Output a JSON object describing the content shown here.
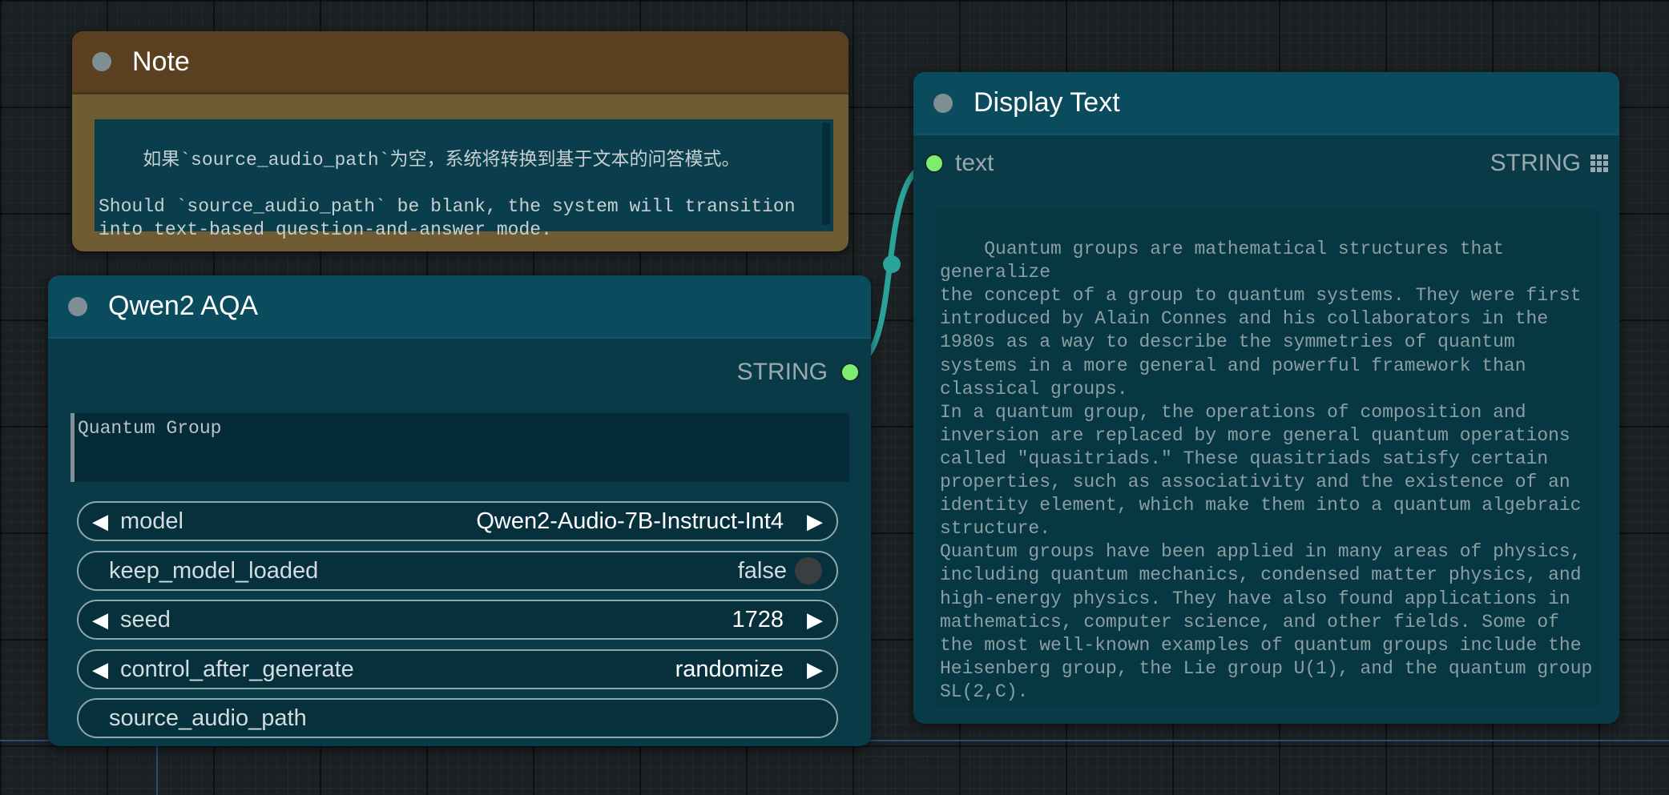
{
  "note": {
    "title": "Note",
    "text": "如果`source_audio_path`为空，系统将转换到基于文本的问答模式。\n\nShould `source_audio_path` be blank, the system will transition\ninto text-based question-and-answer mode."
  },
  "qwen": {
    "title": "Qwen2 AQA",
    "output_type": "STRING",
    "prompt": "Quantum Group",
    "widgets": {
      "model": {
        "label": "model",
        "value": "Qwen2-Audio-7B-Instruct-Int4"
      },
      "keep_model_loaded": {
        "label": "keep_model_loaded",
        "value": "false"
      },
      "seed": {
        "label": "seed",
        "value": "1728"
      },
      "control_after_generate": {
        "label": "control_after_generate",
        "value": "randomize"
      },
      "source_audio_path": {
        "label": "source_audio_path"
      }
    }
  },
  "display": {
    "title": "Display Text",
    "input_label": "text",
    "input_type": "STRING",
    "text": "Quantum groups are mathematical structures that generalize\nthe concept of a group to quantum systems. They were first\nintroduced by Alain Connes and his collaborators in the\n1980s as a way to describe the symmetries of quantum\nsystems in a more general and powerful framework than\nclassical groups.\nIn a quantum group, the operations of composition and\ninversion are replaced by more general quantum operations\ncalled \"quasitriads.\" These quasitriads satisfy certain\nproperties, such as associativity and the existence of an\nidentity element, which make them into a quantum algebraic\nstructure.\nQuantum groups have been applied in many areas of physics,\nincluding quantum mechanics, condensed matter physics, and\nhigh-energy physics. They have also found applications in\nmathematics, computer science, and other fields. Some of\nthe most well-known examples of quantum groups include the\nHeisenberg group, the Lie group U(1), and the quantum group\nSL(2,C)."
  },
  "colors": {
    "slot_connected": "#7eec6e",
    "link": "#2aa39a",
    "node_body": "#093a48",
    "node_header": "#0b4b5e",
    "note_header": "#5a3f20",
    "note_body": "#6f5c32"
  }
}
